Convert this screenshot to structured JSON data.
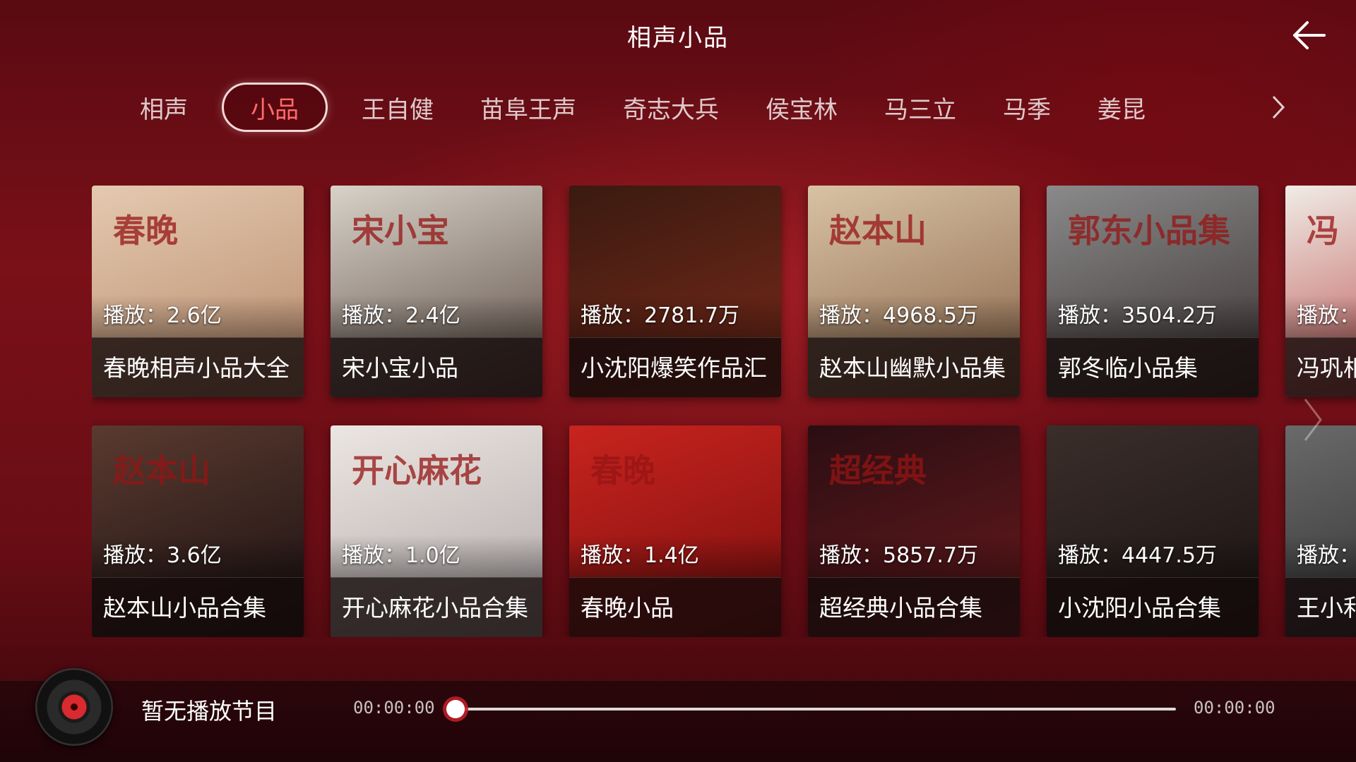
{
  "header": {
    "title": "相声小品"
  },
  "tabs": [
    {
      "label": "相声"
    },
    {
      "label": "小品",
      "active": true
    },
    {
      "label": "王自健"
    },
    {
      "label": "苗阜王声"
    },
    {
      "label": "奇志大兵"
    },
    {
      "label": "侯宝林"
    },
    {
      "label": "马三立"
    },
    {
      "label": "马季"
    },
    {
      "label": "姜昆"
    }
  ],
  "albums": [
    {
      "plays": "播放：2.6亿",
      "name": "春晚相声小品大全",
      "bg": [
        "#e4c9b0",
        "#b88a6a"
      ],
      "deco": "春晚"
    },
    {
      "plays": "播放：2.4亿",
      "name": "宋小宝小品",
      "bg": [
        "#d8d2c8",
        "#5a4a42"
      ],
      "deco": "宋小宝"
    },
    {
      "plays": "播放：2781.7万",
      "name": "小沈阳爆笑作品汇",
      "bg": [
        "#3a1a10",
        "#7a2a1a"
      ],
      "deco": ""
    },
    {
      "plays": "播放：4968.5万",
      "name": "赵本山幽默小品集",
      "bg": [
        "#d8c2a4",
        "#8a6448"
      ],
      "deco": "赵本山"
    },
    {
      "plays": "播放：3504.2万",
      "name": "郭冬临小品集",
      "bg": [
        "#8a8a8a",
        "#3a3030"
      ],
      "deco": "郭东小品集"
    },
    {
      "plays": "播放：",
      "name": "冯巩相",
      "bg": [
        "#f0ece6",
        "#b33a3a"
      ],
      "deco": "冯"
    },
    {
      "plays": "播放：3.6亿",
      "name": "赵本山小品合集",
      "bg": [
        "#5a3a30",
        "#1a1010"
      ],
      "deco": "赵本山"
    },
    {
      "plays": "播放：1.0亿",
      "name": "开心麻花小品合集",
      "bg": [
        "#ece6e2",
        "#b0a8a8"
      ],
      "deco": "开心麻花"
    },
    {
      "plays": "播放：1.4亿",
      "name": "春晚小品",
      "bg": [
        "#c8241e",
        "#7a0e0e"
      ],
      "deco": "春晚"
    },
    {
      "plays": "播放：5857.7万",
      "name": "超经典小品合集",
      "bg": [
        "#2a0e12",
        "#6a1a1e"
      ],
      "deco": "超经典"
    },
    {
      "plays": "播放：4447.5万",
      "name": "小沈阳小品合集",
      "bg": [
        "#3a2e2a",
        "#1a1212"
      ],
      "deco": ""
    },
    {
      "plays": "播放：",
      "name": "王小利",
      "bg": [
        "#6a6a6a",
        "#2a2a2a"
      ],
      "deco": ""
    }
  ],
  "player": {
    "now_playing": "暂无播放节目",
    "time_current": "00:00:00",
    "time_total": "00:00:00",
    "progress": 0
  }
}
